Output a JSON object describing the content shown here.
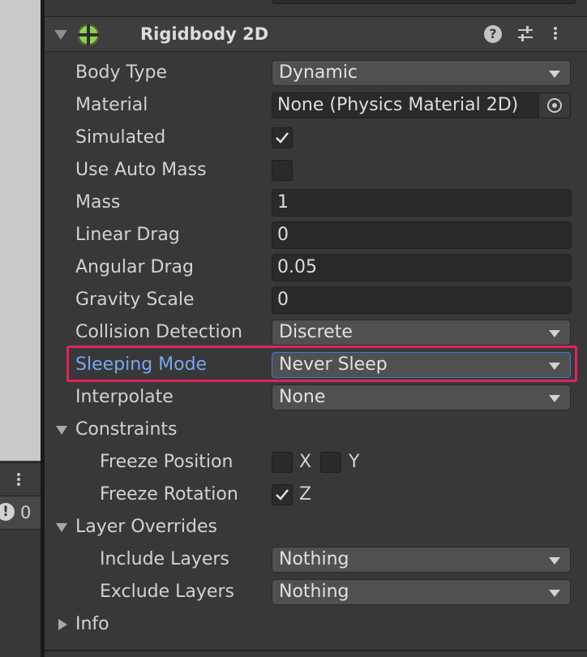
{
  "component": {
    "title": "Rigidbody 2D",
    "icon": "rigidbody2d-icon",
    "header_icons": [
      "help-icon",
      "presets-icon",
      "more-icon"
    ]
  },
  "fields": {
    "body_type": {
      "label": "Body Type",
      "value": "Dynamic"
    },
    "material": {
      "label": "Material",
      "value": "None (Physics Material 2D)"
    },
    "simulated": {
      "label": "Simulated",
      "checked": true
    },
    "use_auto_mass": {
      "label": "Use Auto Mass",
      "checked": false
    },
    "mass": {
      "label": "Mass",
      "value": "1"
    },
    "linear_drag": {
      "label": "Linear Drag",
      "value": "0"
    },
    "angular_drag": {
      "label": "Angular Drag",
      "value": "0.05"
    },
    "gravity_scale": {
      "label": "Gravity Scale",
      "value": "0"
    },
    "collision_detection": {
      "label": "Collision Detection",
      "value": "Discrete"
    },
    "sleeping_mode": {
      "label": "Sleeping Mode",
      "value": "Never Sleep",
      "highlighted": true
    },
    "interpolate": {
      "label": "Interpolate",
      "value": "None"
    }
  },
  "constraints": {
    "label": "Constraints",
    "freeze_position": {
      "label": "Freeze Position",
      "x_label": "X",
      "y_label": "Y",
      "x": false,
      "y": false
    },
    "freeze_rotation": {
      "label": "Freeze Rotation",
      "z_label": "Z",
      "z": true
    }
  },
  "layer_overrides": {
    "label": "Layer Overrides",
    "include_layers": {
      "label": "Include Layers",
      "value": "Nothing"
    },
    "exclude_layers": {
      "label": "Exclude Layers",
      "value": "Nothing"
    }
  },
  "info": {
    "label": "Info"
  },
  "console": {
    "warning_count": "0"
  },
  "colors": {
    "highlight_border": "#e0245e",
    "active_label": "#7aa6f0",
    "icon_green": "#8ed14a"
  }
}
